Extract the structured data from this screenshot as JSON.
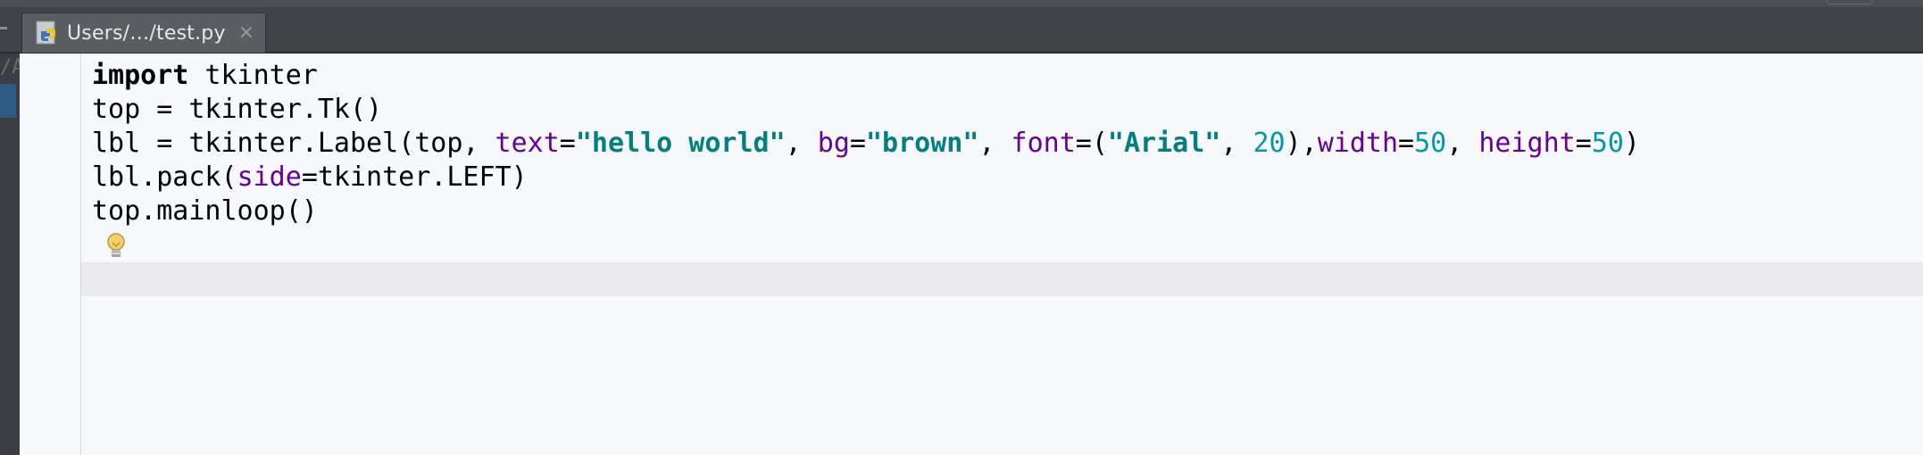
{
  "tab": {
    "label": "Users/…/test.py",
    "close_glyph": "×",
    "icon": "python-file-icon"
  },
  "left_strip": {
    "text": "/A"
  },
  "editor": {
    "lines": [
      [
        {
          "t": "import",
          "c": "kw-import"
        },
        {
          "t": " tkinter",
          "c": "plain"
        }
      ],
      [
        {
          "t": "top = tkinter.Tk()",
          "c": "plain"
        }
      ],
      [
        {
          "t": "lbl = tkinter.Label(top, ",
          "c": "plain"
        },
        {
          "t": "text",
          "c": "param"
        },
        {
          "t": "=",
          "c": "plain"
        },
        {
          "t": "\"hello world\"",
          "c": "str"
        },
        {
          "t": ", ",
          "c": "plain"
        },
        {
          "t": "bg",
          "c": "param"
        },
        {
          "t": "=",
          "c": "plain"
        },
        {
          "t": "\"brown\"",
          "c": "str"
        },
        {
          "t": ", ",
          "c": "plain"
        },
        {
          "t": "font",
          "c": "param"
        },
        {
          "t": "=(",
          "c": "plain"
        },
        {
          "t": "\"Arial\"",
          "c": "str"
        },
        {
          "t": ", ",
          "c": "plain"
        },
        {
          "t": "20",
          "c": "num"
        },
        {
          "t": "),",
          "c": "plain"
        },
        {
          "t": "width",
          "c": "param"
        },
        {
          "t": "=",
          "c": "plain"
        },
        {
          "t": "50",
          "c": "num"
        },
        {
          "t": ", ",
          "c": "plain"
        },
        {
          "t": "height",
          "c": "param"
        },
        {
          "t": "=",
          "c": "plain"
        },
        {
          "t": "50",
          "c": "num"
        },
        {
          "t": ")",
          "c": "plain"
        }
      ],
      [
        {
          "t": "lbl.pack(",
          "c": "plain"
        },
        {
          "t": "side",
          "c": "param"
        },
        {
          "t": "=tkinter.LEFT)",
          "c": "plain"
        }
      ],
      [
        {
          "t": "top.mainloop()",
          "c": "plain"
        }
      ],
      [],
      []
    ],
    "intention_icon": "lightbulb-icon"
  },
  "colors": {
    "keyword": "#000000",
    "param": "#660099",
    "string": "#008080",
    "number": "#0099aa",
    "caret_line": "#e9e9ee",
    "editor_bg": "#f7f8fb"
  }
}
